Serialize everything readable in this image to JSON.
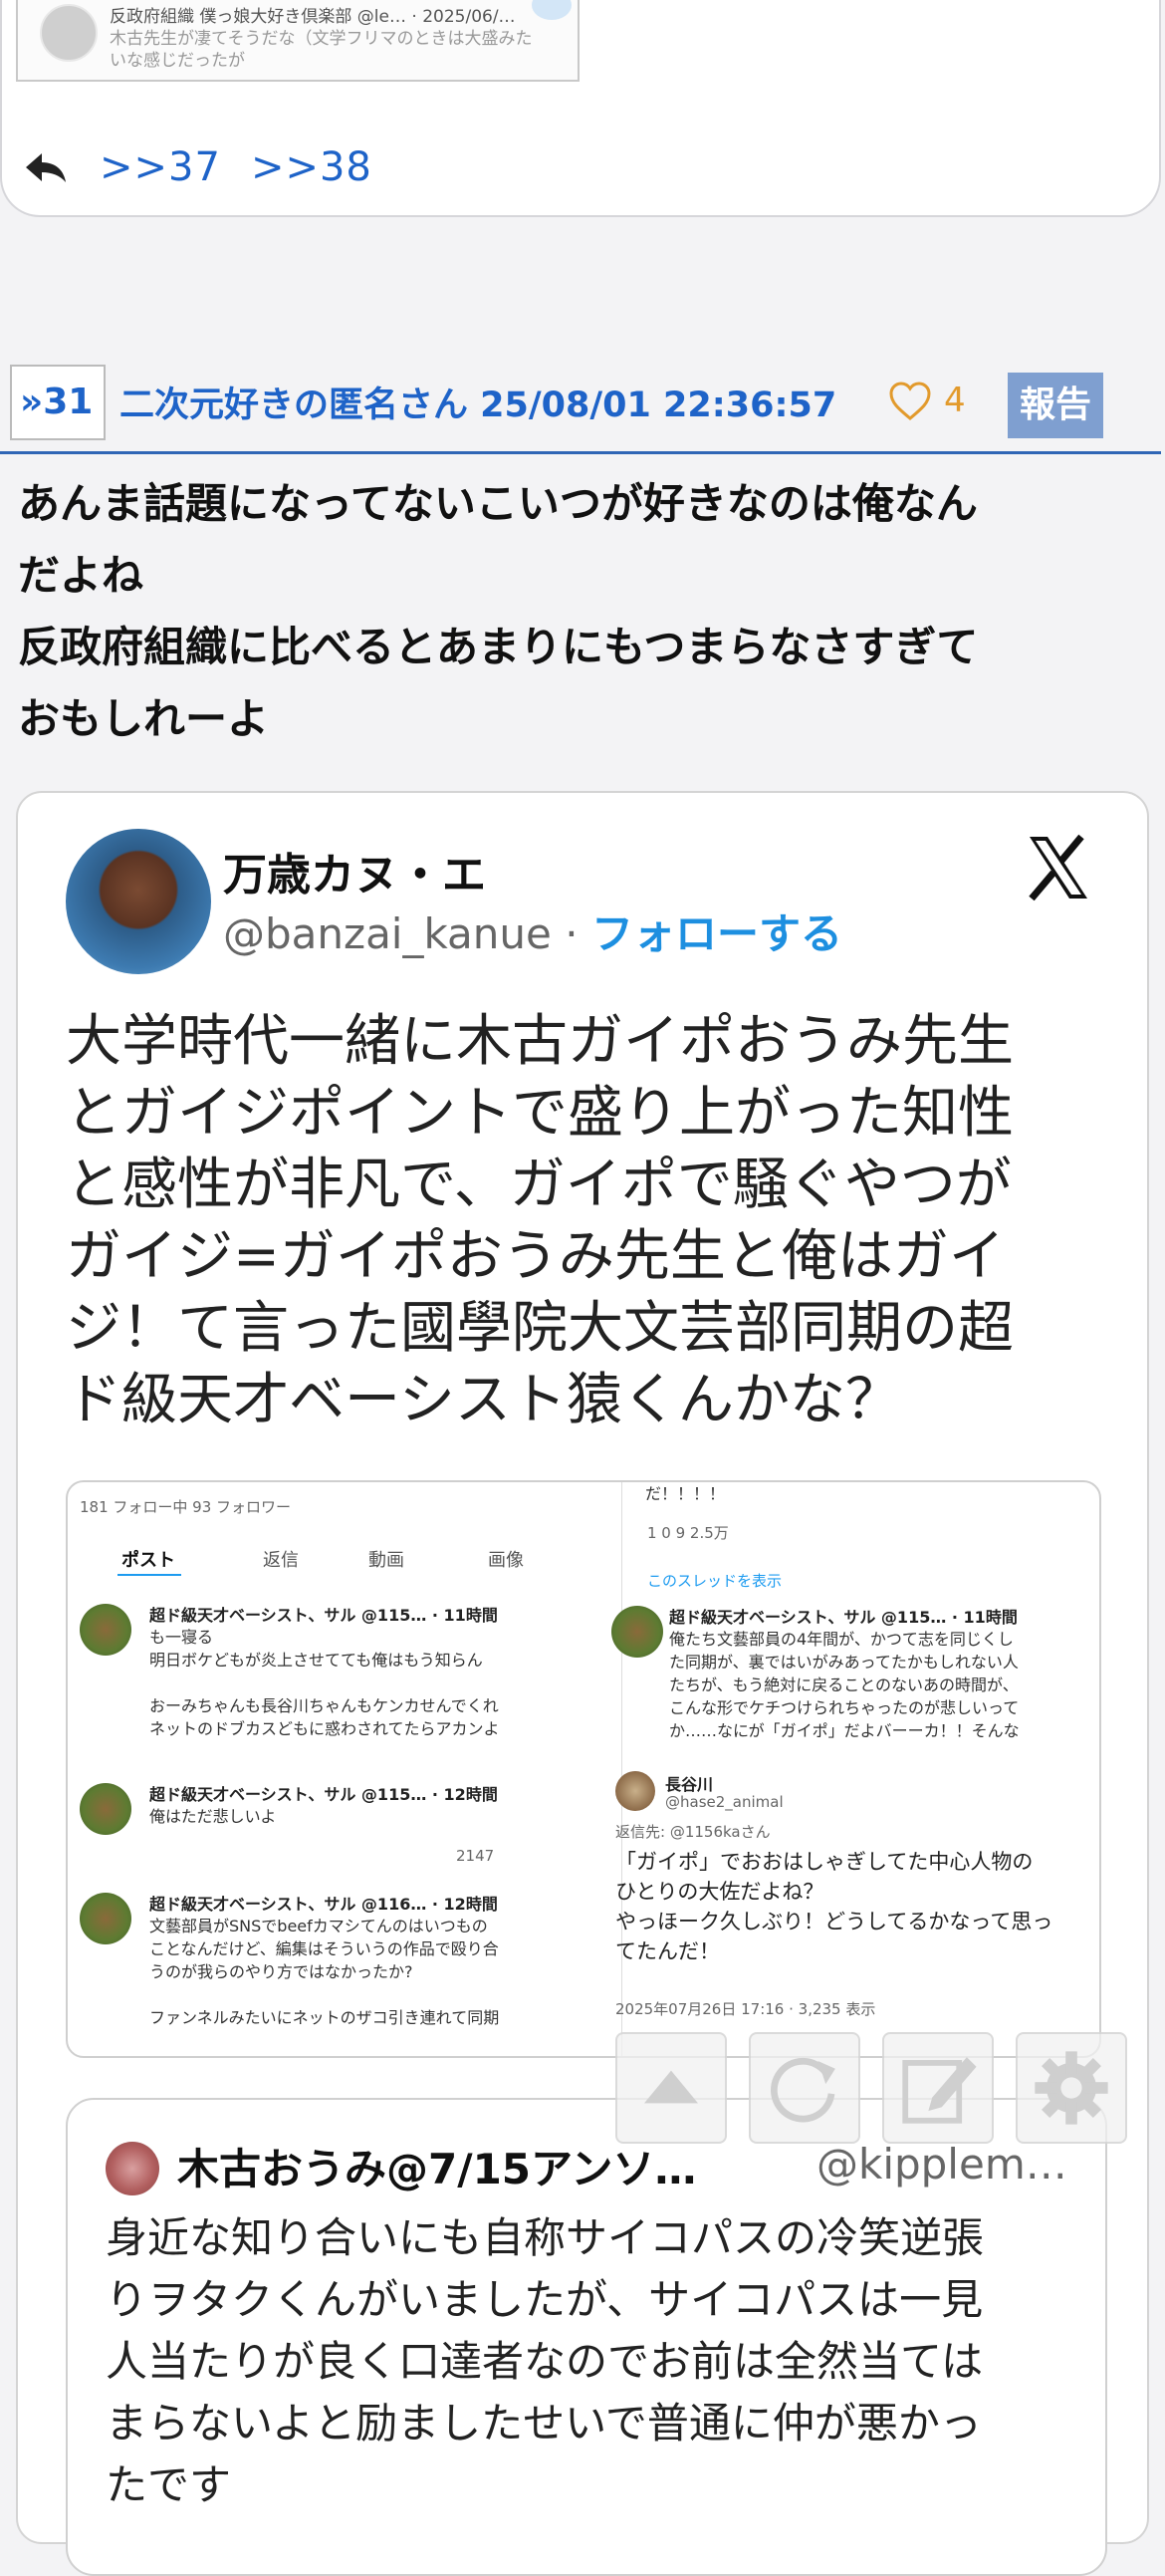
{
  "prev_post": {
    "thumb_line1": "反政府組織 僕っ娘大好き倶楽部 @le… · 2025/06/…",
    "thumb_line2": "木古先生が凄てそうだな（文学フリマのときは大盛みた",
    "thumb_line3": "いな感じだったが",
    "anchors": [
      ">>37",
      ">>38"
    ]
  },
  "post": {
    "number": "»31",
    "author_date": "二次元好きの匿名さん 25/08/01 22:36:57",
    "likes": "4",
    "report_label": "報告",
    "body_lines": [
      "あんま話題になってないこいつが好きなのは俺なん",
      "だよね",
      "反政府組織に比べるとあまりにもつまらなさすぎて",
      "おもしれーよ"
    ]
  },
  "tweet": {
    "name": "万歳カヌ・エ",
    "handle": "@banzai_kanue",
    "separator": " · ",
    "follow_label": "フォローする",
    "text_lines": [
      "大学時代一緒に木古ガイポおうみ先生",
      "とガイジポイントで盛り上がった知性",
      "と感性が非凡で、ガイポで騒ぐやつが",
      "ガイジ=ガイポおうみ先生と俺はガイ",
      "ジ！て言った國學院大文芸部同期の超",
      "ド級天才ベーシスト猿くんかな？"
    ],
    "screenshot": {
      "follow_stats": "181 フォロー中  93 フォロワー",
      "tabs": [
        "ポスト",
        "返信",
        "動画",
        "画像"
      ],
      "left_posts": [
        {
          "name": "超ド級天才ベーシスト、サル @115… · 11時間",
          "lines": [
            "も一寝る",
            "明日ボケどもが炎上させてても俺はもう知らん",
            "",
            "おーみちゃんも長谷川ちゃんもケンカせんでくれ",
            "ネットのドブカスどもに惑わされてたらアカンよ"
          ]
        },
        {
          "name": "超ド級天才ベーシスト、サル @115… · 12時間",
          "lines": [
            "俺はただ悲しいよ"
          ],
          "views": "2147"
        },
        {
          "name": "超ド級天才ベーシスト、サル @116… · 12時間",
          "lines": [
            "文藝部員がSNSでbeefカマシてんのはいつもの",
            "ことなんだけど、編集はそういうの作品で殴り合",
            "うのが我らのやり方ではなかったか?",
            "",
            "ファンネルみたいにネットのザコ引き連れて同期"
          ]
        }
      ],
      "right_top": "だ！！！！",
      "right_stats": "1   0   9   2.5万",
      "thread_link": "このスレッドを表示",
      "right_post": {
        "name": "超ド級天才ベーシスト、サル @115… · 11時間",
        "lines": [
          "俺たち文藝部員の4年間が、かつて志を同じくし",
          "た同期が、裏ではいがみあってたかもしれない人",
          "たちが、もう絶対に戻ることのないあの時間が、",
          "こんな形でケチつけられちゃったのが悲しいって",
          "か……なにが「ガイポ」だよバーーカ！！そんな"
        ]
      },
      "reply_name": "長谷川",
      "reply_handle": "@hase2_animal",
      "reply_to": "返信先: @1156kaさん",
      "reply_lines": [
        "「ガイポ」でおおはしゃぎしてた中心人物の",
        "ひとりの大佐だよね？",
        "やっほーク久しぶり！どうしてるかなって思っ",
        "てたんだ！"
      ],
      "reply_meta": "2025年07月26日 17:16 · 3,235 表示"
    }
  },
  "quote": {
    "name": "木古おうみ@7/15アンソ…",
    "handle": "@kipplem…",
    "text_lines": [
      "身近な知り合いにも自称サイコパスの冷笑逆張",
      "りヲタクくんがいましたが、サイコパスは一見",
      "人当たりが良く口達者なのでお前は全然当ては",
      "まらないよと励ましたせいで普通に仲が悪かっ",
      "たです"
    ]
  },
  "colors": {
    "link": "#1e63c8",
    "report_bg": "#7f9fd0",
    "like": "#e29a2c",
    "follow": "#1d8fe0"
  }
}
